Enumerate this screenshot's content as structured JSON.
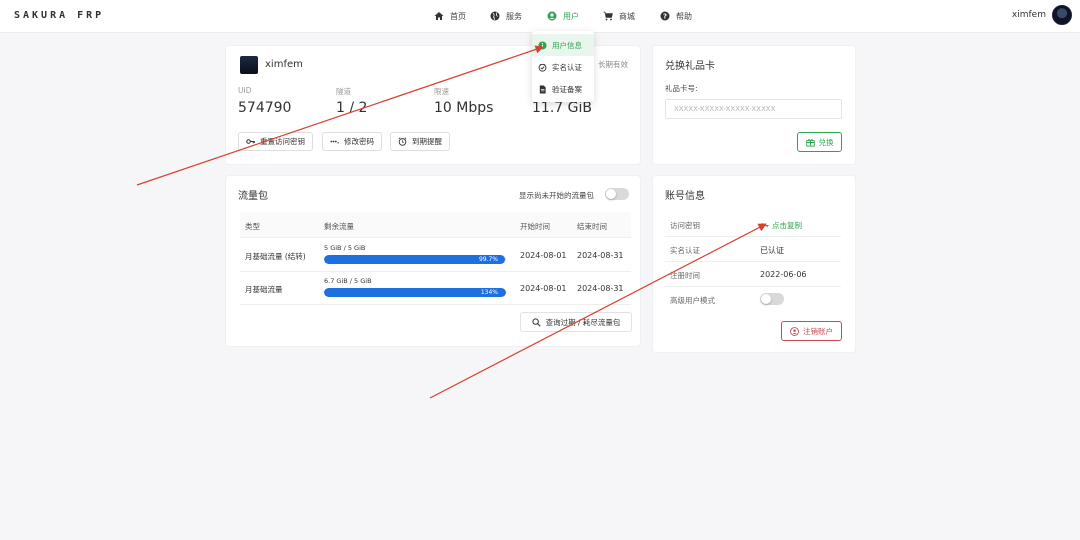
{
  "brand": "SAKURA FRP",
  "nav": {
    "items": [
      {
        "label": "首页",
        "icon": "home-icon"
      },
      {
        "label": "服务",
        "icon": "globe-icon"
      },
      {
        "label": "用户",
        "icon": "user-circle-icon"
      },
      {
        "label": "商城",
        "icon": "cart-icon"
      },
      {
        "label": "帮助",
        "icon": "help-icon"
      }
    ],
    "active_color": "#2ea44f"
  },
  "user_menu": {
    "username": "ximfem"
  },
  "dropdown": {
    "items": [
      {
        "label": "用户信息",
        "icon": "info-icon"
      },
      {
        "label": "实名认证",
        "icon": "verify-icon"
      },
      {
        "label": "验证备案",
        "icon": "file-icon"
      }
    ]
  },
  "user_card": {
    "name": "ximfem",
    "expire": "长期有效",
    "stats": [
      {
        "label": "UID",
        "value": "574790"
      },
      {
        "label": "隧道",
        "value": "1 / 2"
      },
      {
        "label": "限速",
        "value": "10 Mbps"
      },
      {
        "label": "",
        "value": "11.7 GiB"
      }
    ],
    "buttons": {
      "reset_key": "重置访问密钥",
      "change_password": "修改密码",
      "expire_reminder": "到期提醒"
    }
  },
  "gift_card": {
    "title": "兑换礼品卡",
    "label": "礼品卡号:",
    "placeholder": "XXXXX-XXXXX-XXXXX-XXXXX",
    "redeem": "兑换"
  },
  "traffic": {
    "title": "流量包",
    "toggle_label": "显示尚未开始的流量包",
    "columns": [
      "类型",
      "剩余流量",
      "开始时间",
      "结束时间"
    ],
    "rows": [
      {
        "type": "月基础流量 (结转)",
        "usage": "5 GiB / 5 GiB",
        "percent": "99.7%",
        "fill": 0.997,
        "start": "2024-08-01",
        "end": "2024-08-31"
      },
      {
        "type": "月基础流量",
        "usage": "6.7 GiB / 5 GiB",
        "percent": "134%",
        "fill": 1.0,
        "start": "2024-08-01",
        "end": "2024-08-31"
      }
    ],
    "query_button": "查询过期 / 耗尽流量包",
    "bar_color": "#1e6fe0"
  },
  "account": {
    "title": "账号信息",
    "rows": [
      {
        "key": "访问密钥",
        "value": "点击复制"
      },
      {
        "key": "实名认证",
        "value": "已认证"
      },
      {
        "key": "注册时间",
        "value": "2022-06-06"
      },
      {
        "key": "高级用户模式",
        "value": ""
      }
    ],
    "cancel_button": "注销账户",
    "danger_color": "#c64a57"
  },
  "annotation_color": "#d9412f"
}
